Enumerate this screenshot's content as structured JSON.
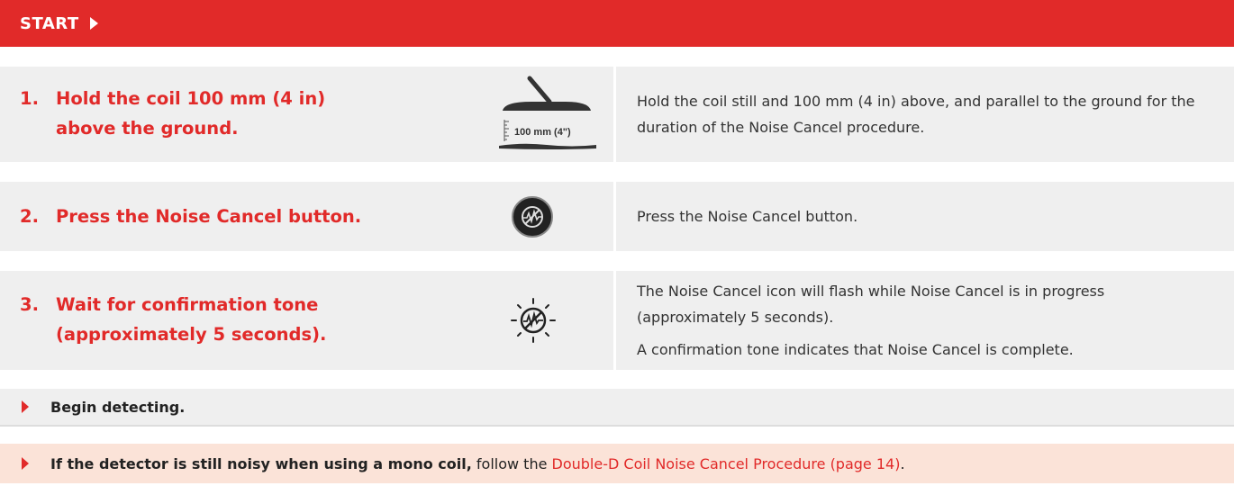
{
  "header": {
    "label": "START"
  },
  "steps": [
    {
      "number": "1.",
      "title_line1": "Hold the coil 100 mm (4 in)",
      "title_line2": "above the ground.",
      "icon": "coil-height-icon",
      "icon_label": "100 mm (4\")",
      "descriptions": [
        "Hold the coil still and 100 mm (4 in) above, and parallel to the ground for the duration of the Noise Cancel procedure."
      ]
    },
    {
      "number": "2.",
      "title_line1": "Press the Noise Cancel button.",
      "icon": "noise-cancel-button-icon",
      "descriptions": [
        "Press the Noise Cancel button."
      ]
    },
    {
      "number": "3.",
      "title_line1": "Wait for confirmation tone",
      "title_line2": "(approximately 5 seconds).",
      "icon": "noise-cancel-flashing-icon",
      "descriptions": [
        "The Noise Cancel icon will flash while Noise Cancel is in progress (approximately 5 seconds).",
        "A confirmation tone indicates that Noise Cancel is complete."
      ]
    }
  ],
  "notes": {
    "begin": "Begin detecting.",
    "mono_bold": "If the detector is still noisy when using a mono coil,",
    "mono_text": " follow the ",
    "mono_link": "Double-D Coil Noise Cancel Procedure (page 14)",
    "mono_end": "."
  },
  "colors": {
    "accent": "#e12a29",
    "row_bg": "#efefef",
    "note_bg": "#fbe3d8"
  }
}
